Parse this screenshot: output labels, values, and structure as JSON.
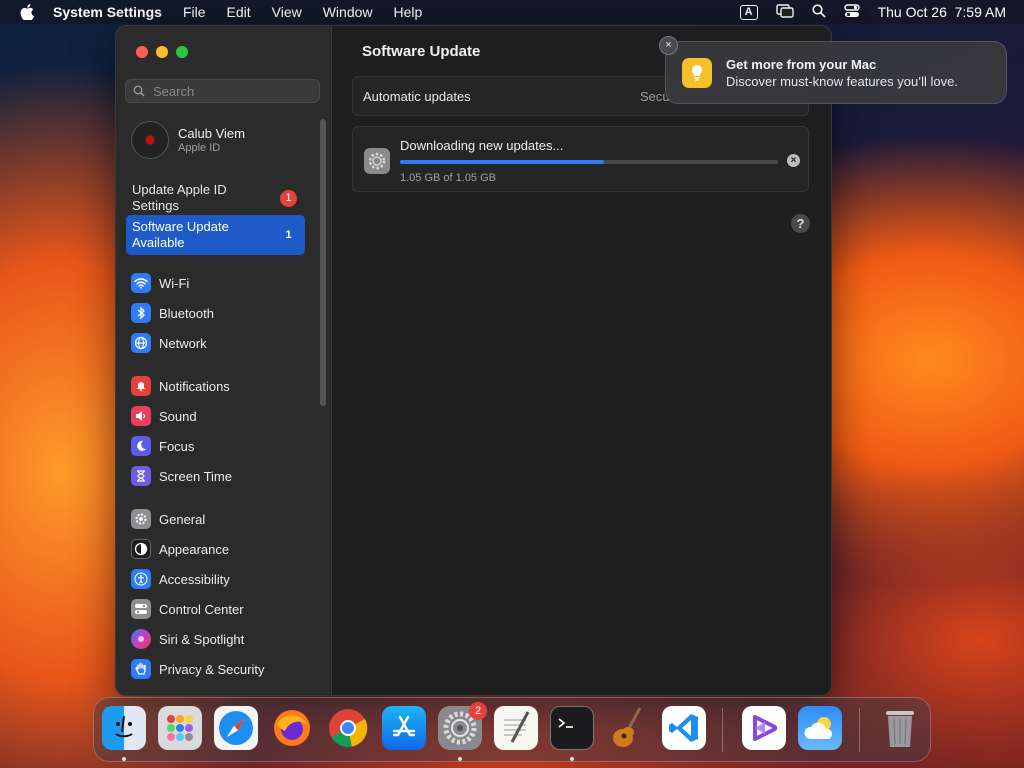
{
  "menubar": {
    "app_name": "System Settings",
    "items": [
      "File",
      "Edit",
      "View",
      "Window",
      "Help"
    ],
    "input_indicator": "A",
    "clock": "Thu Oct 26  7:59 AM"
  },
  "sidebar": {
    "search_placeholder": "Search",
    "user_name": "Calub Viem",
    "user_sub": "Apple ID",
    "notice1": {
      "label": "Update Apple ID Settings",
      "badge": "1"
    },
    "notice2": {
      "label": "Software Update Available",
      "badge": "1"
    },
    "items": [
      {
        "label": "Wi-Fi",
        "icon": "wifi-icon",
        "color": "#2f7cf6"
      },
      {
        "label": "Bluetooth",
        "icon": "bluetooth-icon",
        "color": "#2f7cf6"
      },
      {
        "label": "Network",
        "icon": "globe-icon",
        "color": "#2f7cf6"
      },
      {
        "label": "Notifications",
        "icon": "bell-icon",
        "color": "#e5413b"
      },
      {
        "label": "Sound",
        "icon": "speaker-icon",
        "color": "#e5415f"
      },
      {
        "label": "Focus",
        "icon": "moon-icon",
        "color": "#5e5ce6"
      },
      {
        "label": "Screen Time",
        "icon": "hourglass-icon",
        "color": "#6e5ce6"
      },
      {
        "label": "General",
        "icon": "gear-icon",
        "color": "#8e8e93"
      },
      {
        "label": "Appearance",
        "icon": "appearance-icon",
        "color": "#1c1c1e"
      },
      {
        "label": "Accessibility",
        "icon": "accessibility-icon",
        "color": "#2f7cf6"
      },
      {
        "label": "Control Center",
        "icon": "control-center-icon",
        "color": "#8e8e93"
      },
      {
        "label": "Siri & Spotlight",
        "icon": "siri-icon",
        "color": "#7a3cc8"
      },
      {
        "label": "Privacy & Security",
        "icon": "hand-icon",
        "color": "#2f7cf6"
      }
    ]
  },
  "main": {
    "title": "Software Update",
    "auto_label": "Automatic updates",
    "auto_value": "Secu",
    "download_heading": "Downloading new updates...",
    "download_size": "1.05 GB of 1.05 GB",
    "progress": 0.54,
    "help": "?"
  },
  "notification": {
    "title": "Get more from your Mac",
    "body": "Discover must-know features you’ll love.",
    "close": "×"
  },
  "dock": {
    "apps": [
      "Finder",
      "Launchpad",
      "Safari",
      "Firefox",
      "Chrome",
      "App Store",
      "System Settings",
      "TextEdit",
      "Terminal",
      "GarageBand",
      "VS Code",
      "Visual Studio",
      "Weather",
      "Trash"
    ],
    "settings_badge": "2"
  }
}
